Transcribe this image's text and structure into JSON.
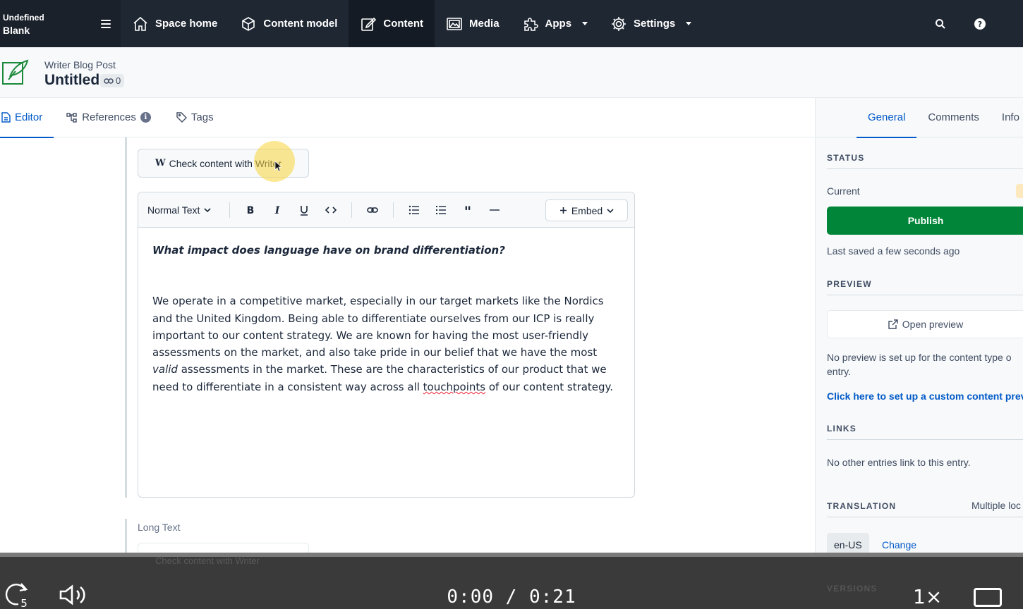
{
  "space": {
    "line1": "Undefined",
    "line2": "Blank"
  },
  "nav": {
    "items": [
      {
        "label": "Space home",
        "icon": "home-icon"
      },
      {
        "label": "Content model",
        "icon": "cube-icon"
      },
      {
        "label": "Content",
        "icon": "edit-icon"
      },
      {
        "label": "Media",
        "icon": "image-icon"
      },
      {
        "label": "Apps",
        "icon": "puzzle-icon"
      },
      {
        "label": "Settings",
        "icon": "gear-icon"
      }
    ]
  },
  "entry": {
    "type": "Writer Blog Post",
    "title": "Untitled",
    "references_count": "0"
  },
  "tabs": {
    "editor": "Editor",
    "references": "References",
    "tags": "Tags"
  },
  "editor": {
    "writer_button": "Check content with Writer",
    "writer_logo": "W",
    "format_select": "Normal Text",
    "embed_label": "Embed",
    "heading": "What impact does language have on brand differentiation?",
    "para_part1": "We operate in a competitive market, especially in our target markets like the Nordics and the United Kingdom. Being able to differentiate ourselves from our ICP is really important to our content strategy. We are known for having the most user-friendly assessments on the market, and also take pride in our belief that we have the most ",
    "para_italic": "valid",
    "para_part2": " assessments in the market. These are the characteristics of our product that we need to differentiate in a consistent way across all ",
    "para_misspelled": "touchpoints",
    "para_part3": " of our content strategy.",
    "next_field_label": "Long Text"
  },
  "sidebar": {
    "tabs": [
      "General",
      "Comments",
      "Info"
    ],
    "status_title": "STATUS",
    "status_current": "Current",
    "publish_label": "Publish",
    "last_saved": "Last saved a few seconds ago",
    "preview_title": "PREVIEW",
    "open_preview": "Open preview",
    "preview_note_line1": "No preview is set up for the content type o",
    "preview_note_line2": "entry.",
    "preview_link": "Click here to set up a custom content prev",
    "links_title": "LINKS",
    "links_text": "No other entries link to this entry.",
    "translation_title": "TRANSLATION",
    "translation_value": "Multiple loc",
    "locale": "en-US",
    "change_label": "Change",
    "versions_title": "VERSIONS"
  },
  "video": {
    "time": "0:00 / 0:21",
    "speed": "1×",
    "replay_seconds": "5",
    "ghost_button": "Check content with Writer"
  },
  "colors": {
    "nav_bg": "#1f2733",
    "accent": "#0059c8",
    "publish": "#008539",
    "video_bg": "#3a3a3a"
  }
}
